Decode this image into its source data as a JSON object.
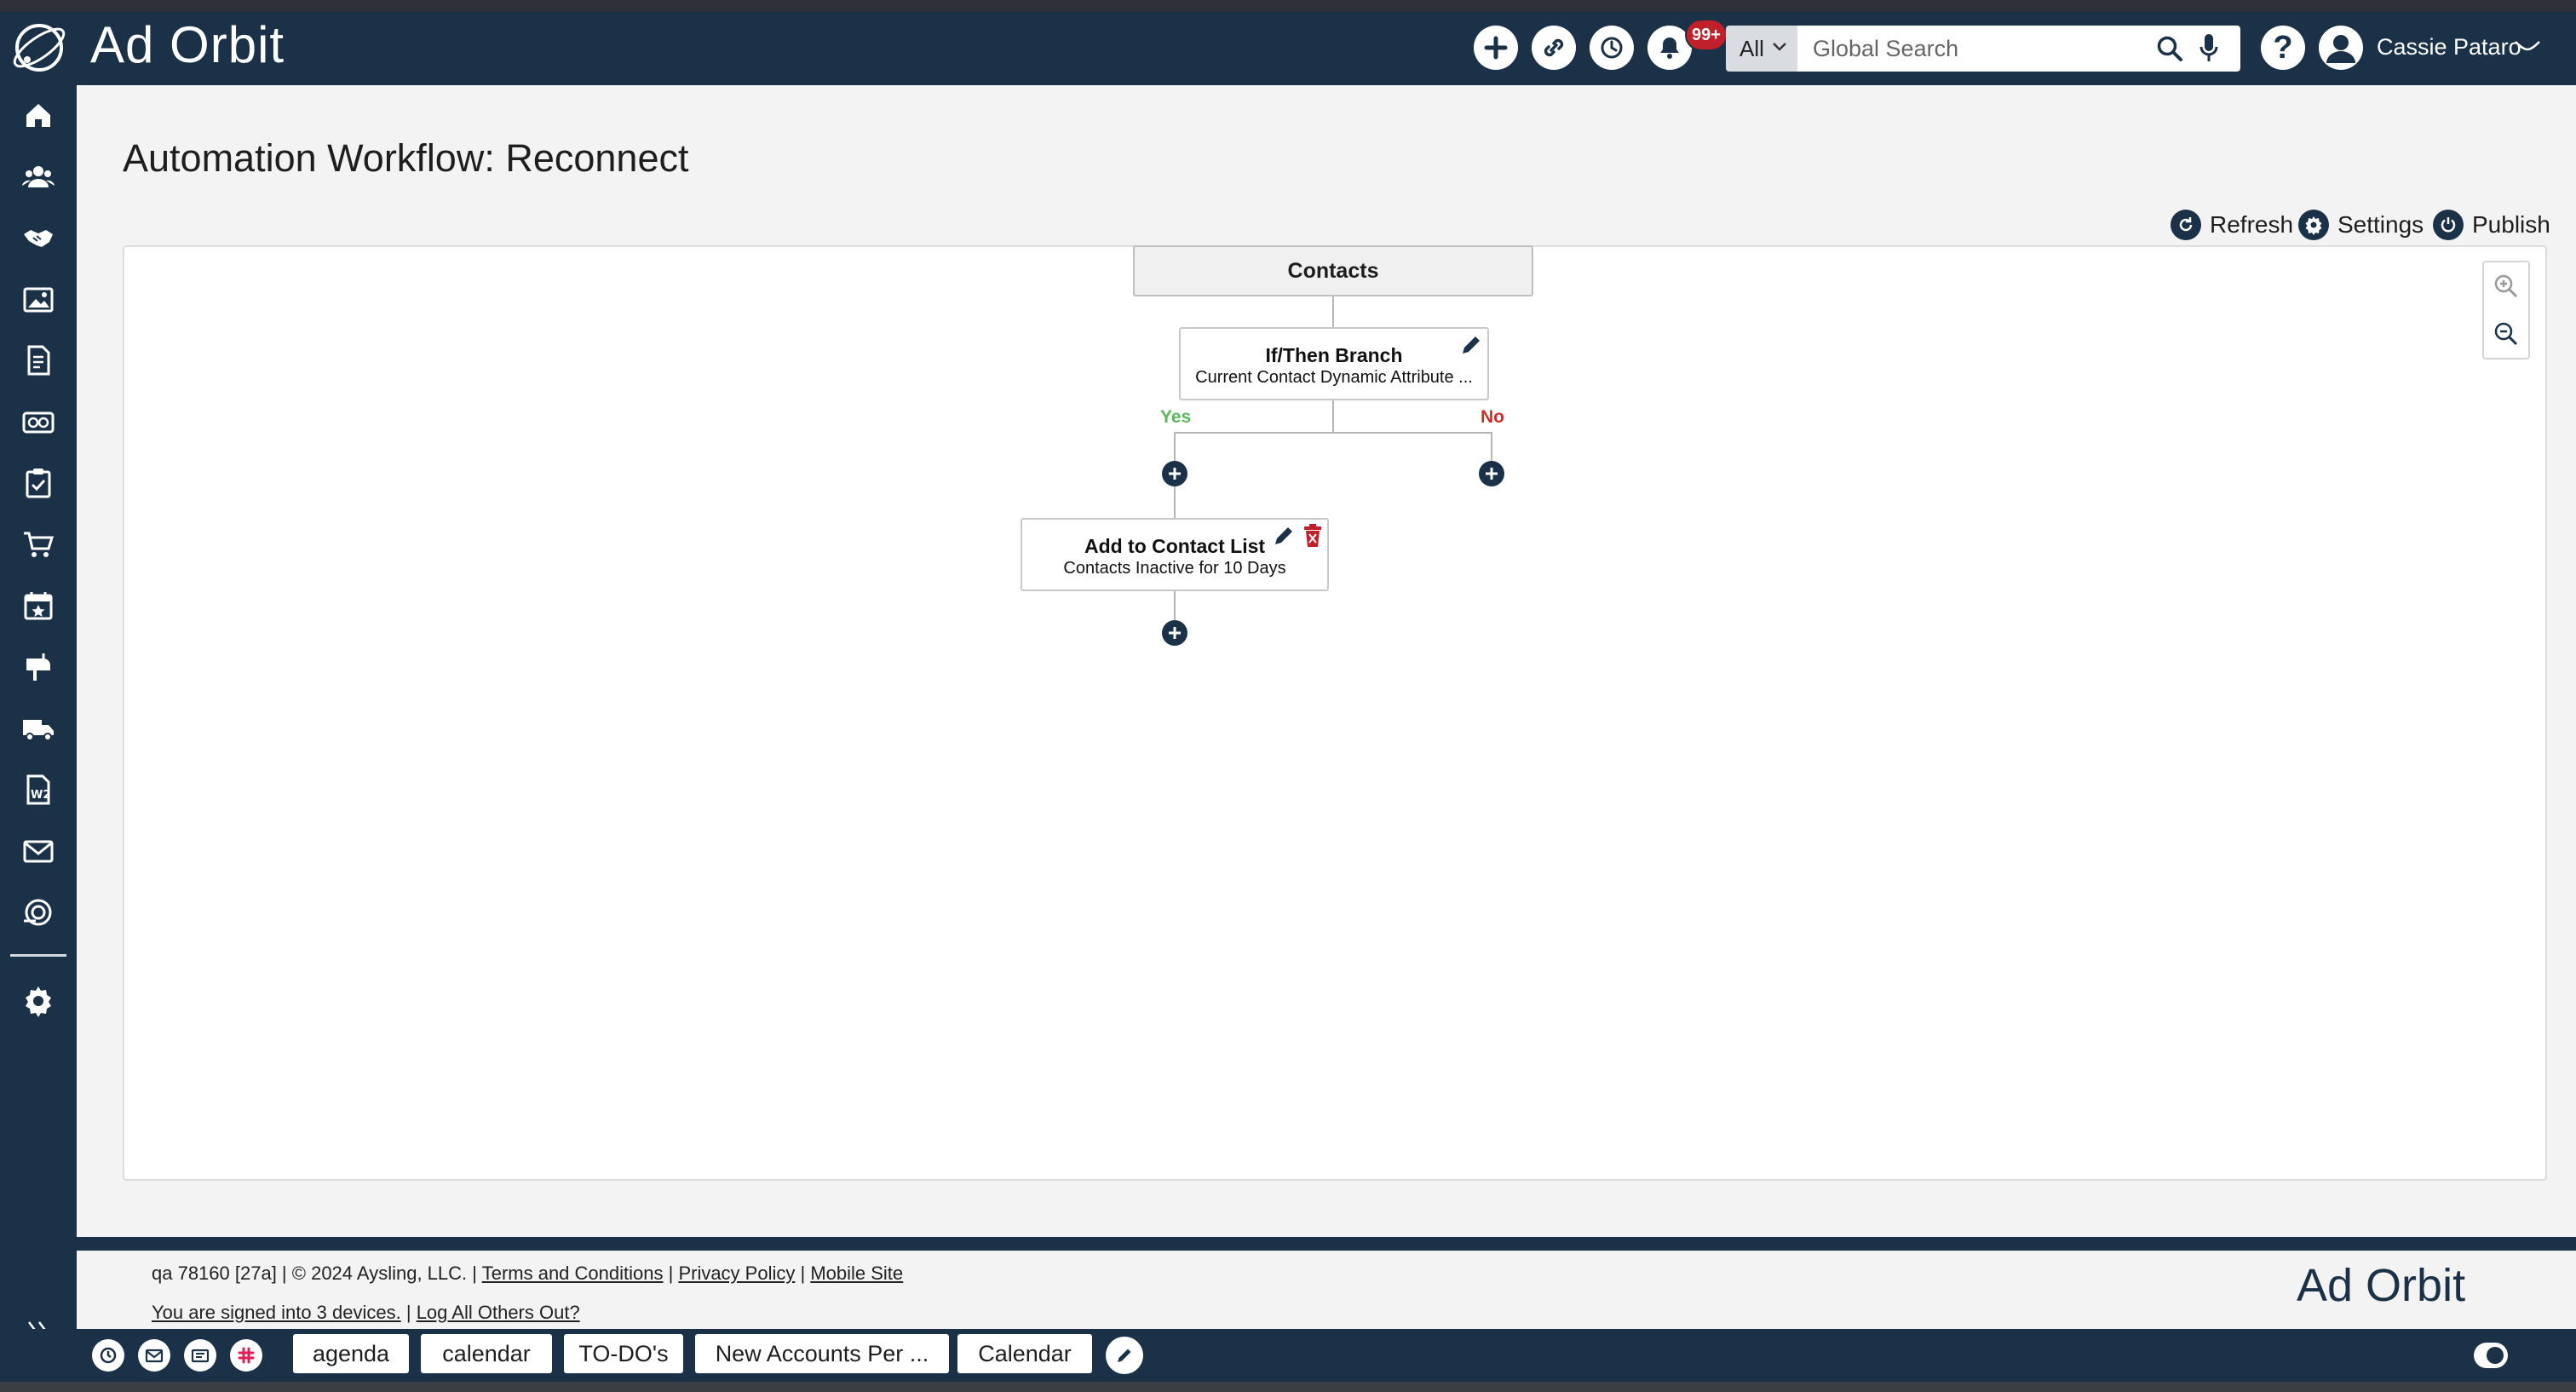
{
  "app": {
    "name": "Ad Orbit",
    "footer_logo": "Ad Orbit"
  },
  "header": {
    "notifications_badge": "99+",
    "search": {
      "scope": "All",
      "placeholder": "Global Search"
    },
    "help_label": "?",
    "user_name": "Cassie Pataro"
  },
  "sidebar": {
    "items": [
      "home-icon",
      "people-icon",
      "handshake-icon",
      "image-icon",
      "document-dollar-icon",
      "money-icon",
      "clipboard-check-icon",
      "cart-icon",
      "calendar-star-icon",
      "mailbox-icon",
      "truck-icon",
      "w2-form-icon",
      "mail-icon",
      "marketing-icon",
      "gear-icon"
    ]
  },
  "page": {
    "title": "Automation Workflow: Reconnect",
    "toolbar": {
      "refresh": "Refresh",
      "settings": "Settings",
      "publish": "Publish"
    }
  },
  "workflow": {
    "root": "Contacts",
    "branch": {
      "title": "If/Then Branch",
      "subtitle": "Current Contact Dynamic Attribute ..."
    },
    "yes_label": "Yes",
    "no_label": "No",
    "action": {
      "title": "Add to Contact List",
      "subtitle": "Contacts Inactive for 10 Days"
    }
  },
  "footer": {
    "build": "qa 78160 [27a]",
    "copyright": "© 2024 Aysling, LLC.",
    "terms": "Terms and Conditions",
    "privacy": "Privacy Policy",
    "mobile": "Mobile Site",
    "signed_in": "You are signed into 3 devices.",
    "log_out_others": "Log All Others Out?"
  },
  "bottombar": {
    "tabs": [
      "agenda",
      "calendar",
      "TO-DO's",
      "New Accounts Per ...",
      "Calendar"
    ]
  },
  "colors": {
    "navy": "#1b3147",
    "badge_red": "#c0202a",
    "yes_green": "#5cb85c",
    "no_red": "#c9302c"
  }
}
